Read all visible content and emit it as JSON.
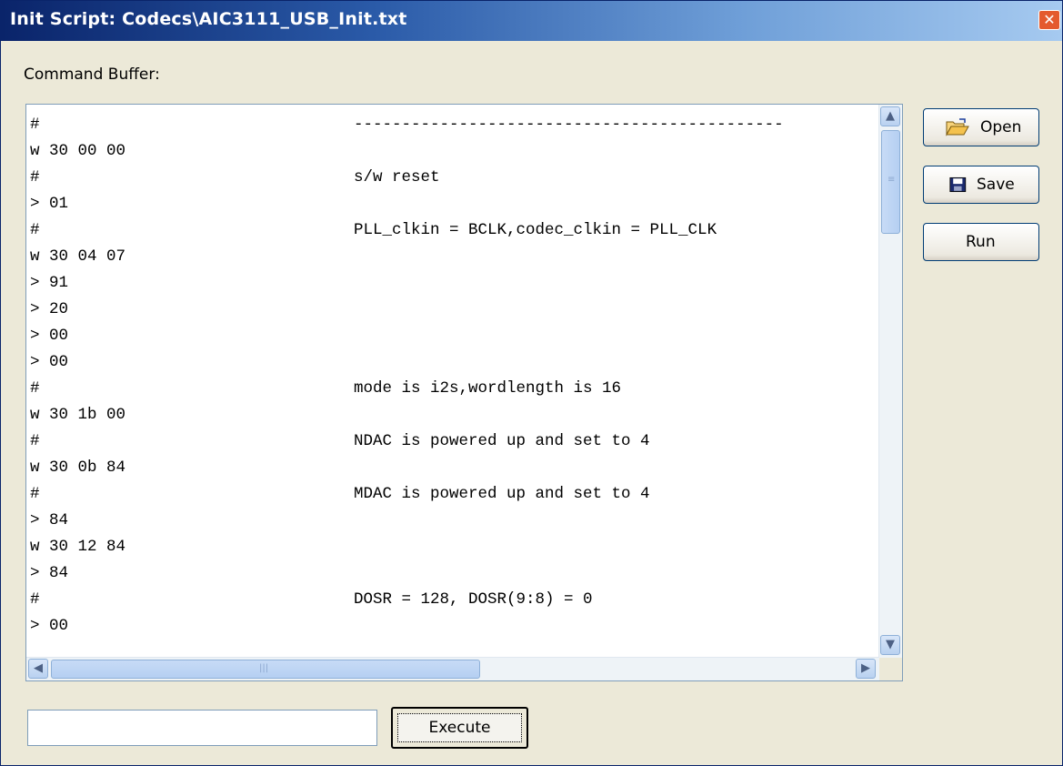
{
  "window": {
    "title": "Init Script: Codecs\\AIC3111_USB_Init.txt",
    "close_glyph": "✕"
  },
  "command_buffer": {
    "label": "Command Buffer:",
    "lines": [
      {
        "cmd": "#",
        "comment": "---------------------------------------------"
      },
      {
        "cmd": "w 30 00 00",
        "comment": ""
      },
      {
        "cmd": "#",
        "comment": "s/w reset"
      },
      {
        "cmd": "> 01",
        "comment": ""
      },
      {
        "cmd": "#",
        "comment": "PLL_clkin = BCLK,codec_clkin = PLL_CLK"
      },
      {
        "cmd": "w 30 04 07",
        "comment": ""
      },
      {
        "cmd": "> 91",
        "comment": ""
      },
      {
        "cmd": "> 20",
        "comment": ""
      },
      {
        "cmd": "> 00",
        "comment": ""
      },
      {
        "cmd": "> 00",
        "comment": ""
      },
      {
        "cmd": "#",
        "comment": "mode is i2s,wordlength is 16"
      },
      {
        "cmd": "w 30 1b 00",
        "comment": ""
      },
      {
        "cmd": "#",
        "comment": "NDAC is powered up and set to 4"
      },
      {
        "cmd": "w 30 0b 84",
        "comment": ""
      },
      {
        "cmd": "#",
        "comment": "MDAC is powered up and set to 4"
      },
      {
        "cmd": "> 84",
        "comment": ""
      },
      {
        "cmd": "w 30 12 84",
        "comment": ""
      },
      {
        "cmd": "> 84",
        "comment": ""
      },
      {
        "cmd": "#",
        "comment": "DOSR = 128, DOSR(9:8) = 0"
      },
      {
        "cmd": "> 00",
        "comment": ""
      }
    ]
  },
  "buttons": {
    "open": "Open",
    "save": "Save",
    "run": "Run",
    "execute": "Execute"
  },
  "input": {
    "value": ""
  },
  "icons": {
    "open": "folder-open-icon",
    "save": "floppy-disk-icon",
    "close": "close-icon"
  },
  "colors": {
    "titlebar_start": "#0a246a",
    "titlebar_end": "#a6caf0",
    "close_button": "#e45a2e",
    "window_bg": "#ece9d8"
  }
}
